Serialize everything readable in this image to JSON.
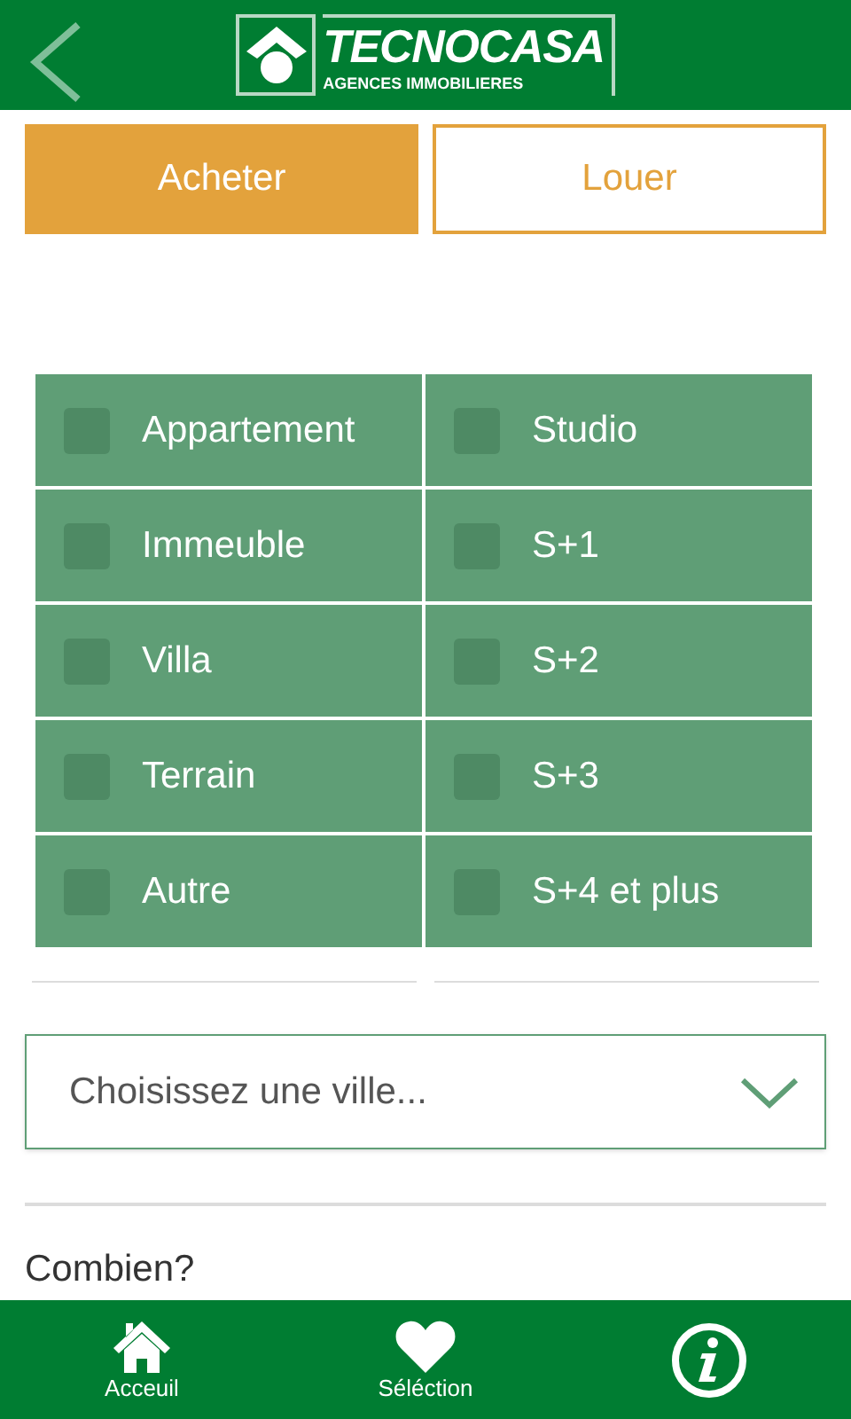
{
  "header": {
    "logo_title": "TECNOCASA",
    "logo_subtitle": "AGENCES IMMOBILIERES"
  },
  "mode_tabs": [
    {
      "label": "Acheter",
      "selected": true
    },
    {
      "label": "Louer",
      "selected": false
    }
  ],
  "property_types": [
    {
      "label": "Appartement",
      "checked": false
    },
    {
      "label": "Studio",
      "checked": false
    },
    {
      "label": "Immeuble",
      "checked": false
    },
    {
      "label": "S+1",
      "checked": false
    },
    {
      "label": "Villa",
      "checked": false
    },
    {
      "label": "S+2",
      "checked": false
    },
    {
      "label": "Terrain",
      "checked": false
    },
    {
      "label": "S+3",
      "checked": false
    },
    {
      "label": "Autre",
      "checked": false
    },
    {
      "label": "S+4 et plus",
      "checked": false
    }
  ],
  "city_select": {
    "placeholder": "Choisissez une ville..."
  },
  "section_label": "Combien?",
  "bottom_nav": [
    {
      "kind": "home",
      "label": "Acceuil"
    },
    {
      "kind": "heart",
      "label": "Séléction"
    },
    {
      "kind": "info"
    }
  ]
}
